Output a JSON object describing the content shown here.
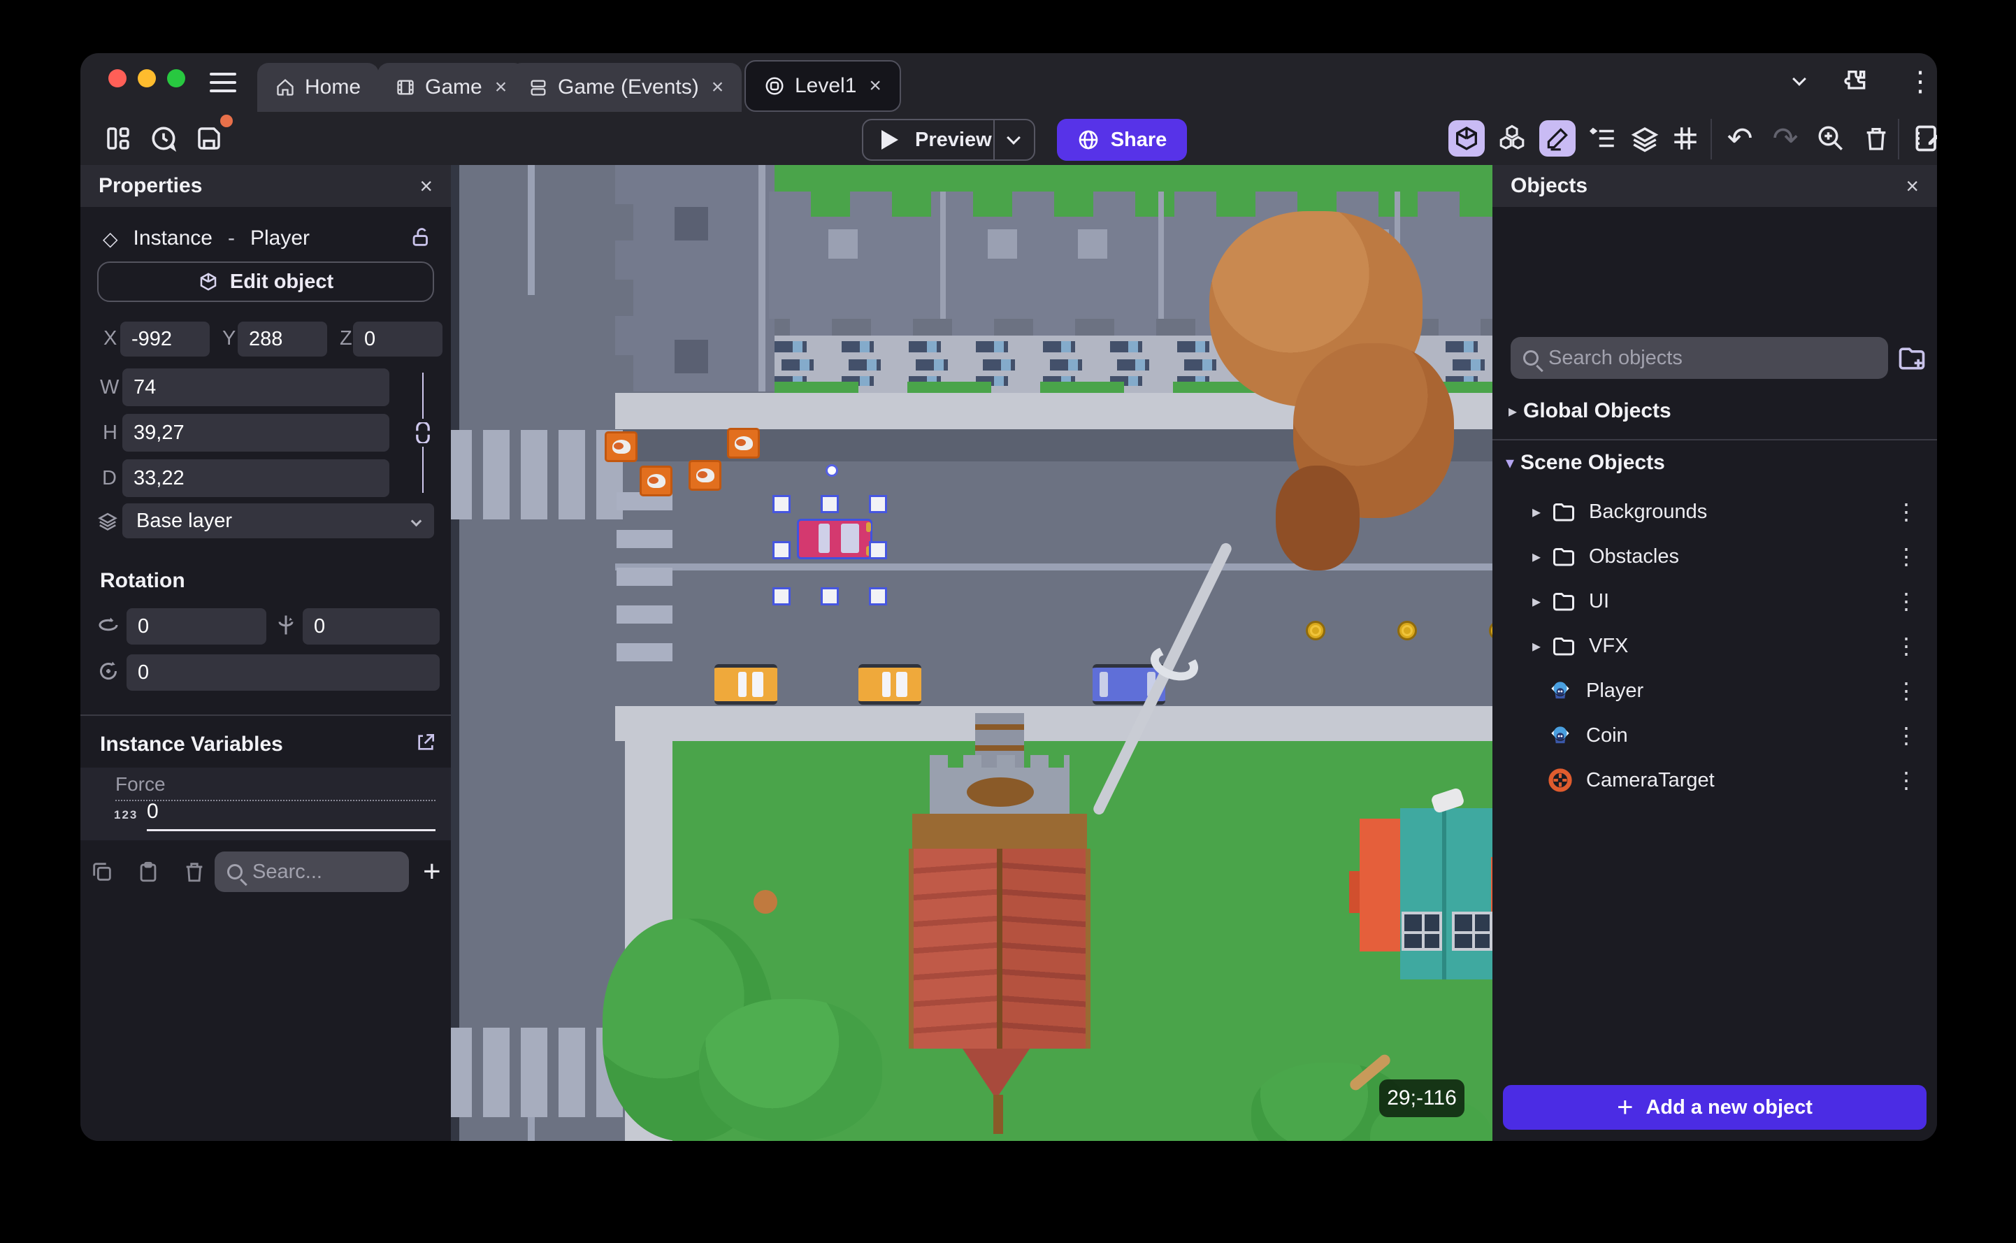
{
  "glyphs": {
    "close": "×",
    "kebab": "⋮",
    "caret_right": "▸",
    "caret_down": "▾",
    "undo": "↶",
    "redo": "↷",
    "diamond": "◇",
    "plus": "+"
  },
  "window": {
    "tabs": [
      {
        "label": "Home"
      },
      {
        "label": "Game",
        "close": "×"
      },
      {
        "label": "Game (Events)",
        "close": "×"
      },
      {
        "label": "Level1",
        "close": "×"
      }
    ]
  },
  "toolbar": {
    "preview_label": "Preview",
    "share_label": "Share"
  },
  "properties": {
    "title": "Properties",
    "instance_type": "Instance",
    "separator": "-",
    "object_name": "Player",
    "edit_object_label": "Edit object",
    "coords": {
      "x_label": "X",
      "x_value": "-992",
      "y_label": "Y",
      "y_value": "288",
      "z_label": "Z",
      "z_value": "0"
    },
    "size": {
      "w_label": "W",
      "w_value": "74",
      "h_label": "H",
      "h_value": "39,27",
      "d_label": "D",
      "d_value": "33,22"
    },
    "layer_value": "Base layer",
    "rotation_title": "Rotation",
    "rotation_x": "0",
    "rotation_y": "0",
    "rotation_z": "0",
    "variables_title": "Instance Variables",
    "variable_name": "Force",
    "variable_type_badge": "123",
    "variable_value": "0",
    "search_placeholder": "Searc..."
  },
  "objects": {
    "title": "Objects",
    "search_placeholder": "Search objects",
    "global_group": "Global Objects",
    "scene_group": "Scene Objects",
    "folders": [
      "Backgrounds",
      "Obstacles",
      "UI",
      "VFX"
    ],
    "items": [
      "Player",
      "Coin",
      "CameraTarget"
    ],
    "add_label": "Add a new object"
  },
  "scene": {
    "cursor_coordinates": "29;-116"
  },
  "colors": {
    "accent": "#5733e8",
    "add_button": "#4b2ce4",
    "active_toggle": "#c9bbf4",
    "save_badge": "#e8704a",
    "road": "#6c7282",
    "grass": "#4aa44a",
    "sidewalk": "#c6c9d2"
  }
}
